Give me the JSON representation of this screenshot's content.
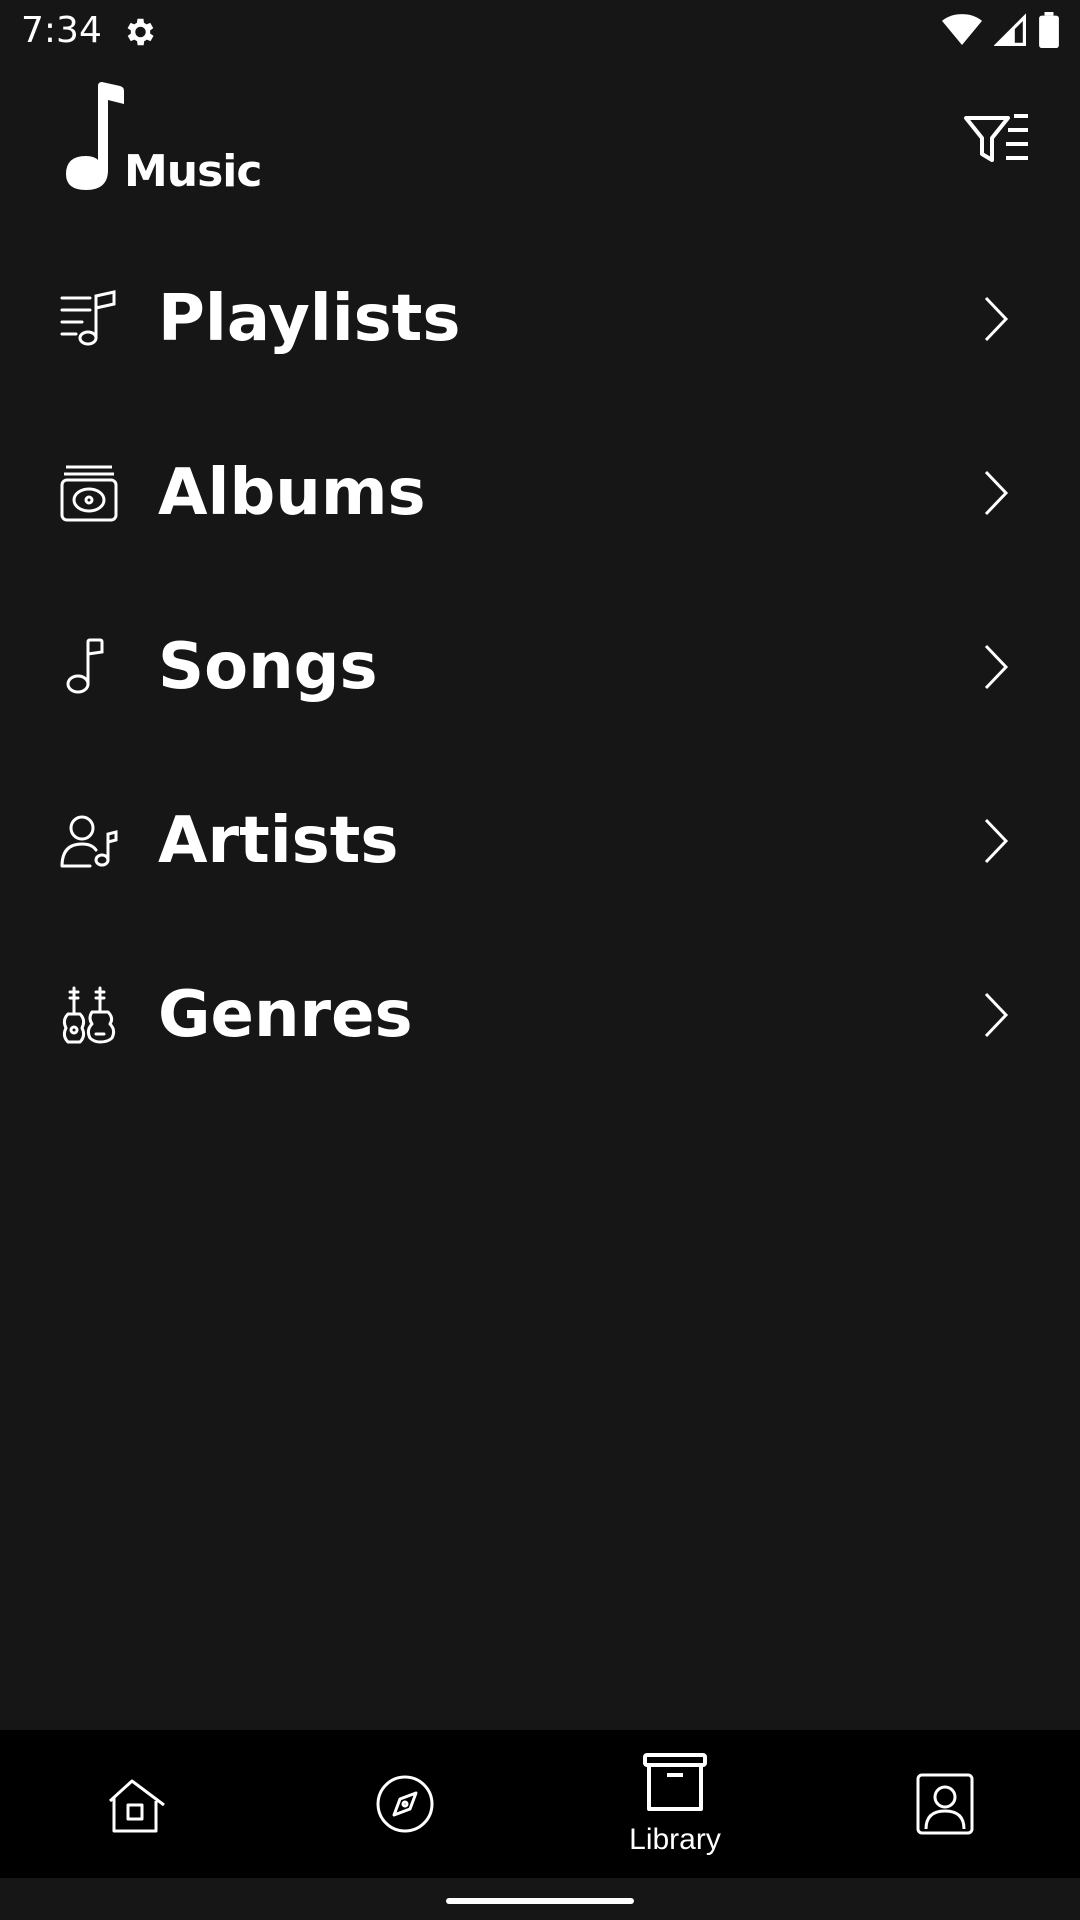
{
  "status_bar": {
    "time": "7:34",
    "icons": [
      "settings-icon",
      "wifi-icon",
      "signal-icon",
      "battery-icon"
    ]
  },
  "header": {
    "app_name": "Music",
    "filter_icon": "filter-list-icon"
  },
  "library_items": [
    {
      "label": "Playlists",
      "icon": "playlist-icon"
    },
    {
      "label": "Albums",
      "icon": "album-icon"
    },
    {
      "label": "Songs",
      "icon": "music-note-icon"
    },
    {
      "label": "Artists",
      "icon": "artist-icon"
    },
    {
      "label": "Genres",
      "icon": "guitar-icon"
    }
  ],
  "bottom_nav": {
    "items": [
      {
        "label": "",
        "icon": "home-icon",
        "selected": false
      },
      {
        "label": "",
        "icon": "compass-icon",
        "selected": false
      },
      {
        "label": "Library",
        "icon": "archive-box-icon",
        "selected": true
      },
      {
        "label": "",
        "icon": "profile-icon",
        "selected": false
      }
    ]
  },
  "colors": {
    "background": "#161616",
    "nav_background": "#000000",
    "foreground": "#ffffff"
  }
}
